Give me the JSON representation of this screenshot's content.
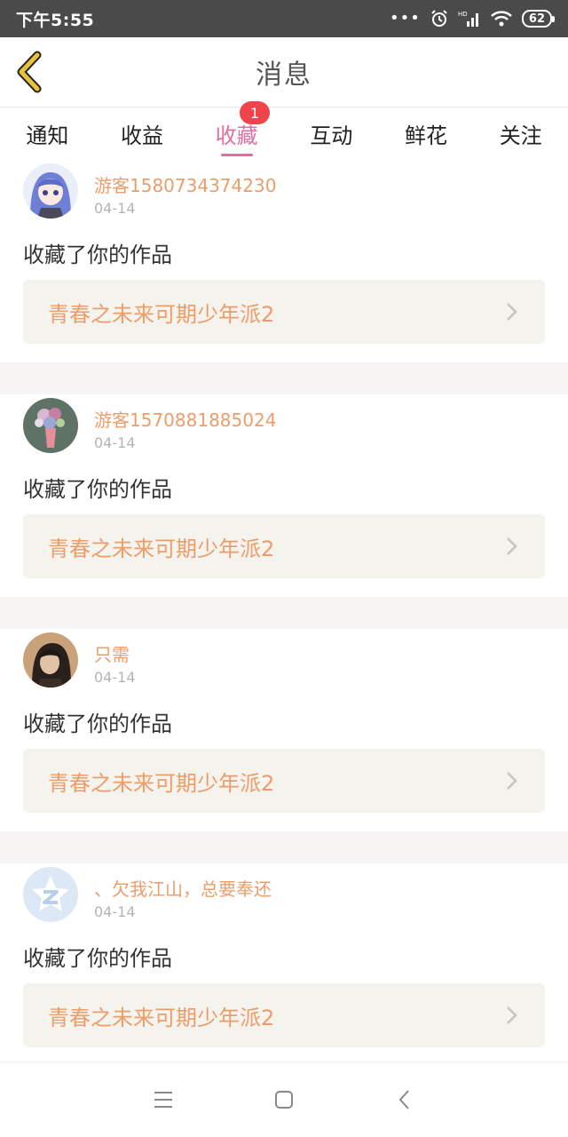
{
  "status_bar": {
    "time": "下午5:55",
    "dots": "•••",
    "battery": "62"
  },
  "header": {
    "title": "消息"
  },
  "tabs": [
    {
      "label": "通知",
      "active": false
    },
    {
      "label": "收益",
      "active": false
    },
    {
      "label": "收藏",
      "active": true,
      "badge": "1"
    },
    {
      "label": "互动",
      "active": false
    },
    {
      "label": "鲜花",
      "active": false
    },
    {
      "label": "关注",
      "active": false
    }
  ],
  "items": [
    {
      "name": "游客1580734374230",
      "date": "04-14",
      "action": "收藏了你的作品",
      "work": "青春之未来可期少年派2",
      "avatar": "anime-girl-avatar"
    },
    {
      "name": "游客1570881885024",
      "date": "04-14",
      "action": "收藏了你的作品",
      "work": "青春之未来可期少年派2",
      "avatar": "flower-vase-avatar"
    },
    {
      "name": "只需",
      "date": "04-14",
      "action": "收藏了你的作品",
      "work": "青春之未来可期少年派2",
      "avatar": "portrait-avatar"
    },
    {
      "name": "、欠我江山，总要奉还",
      "date": "04-14",
      "action": "收藏了你的作品",
      "work": "青春之未来可期少年派2",
      "avatar": "qzone-default-avatar"
    }
  ],
  "colors": {
    "accent": "#e46d9f",
    "name": "#ec9d6a",
    "badge": "#f0434b",
    "back_icon": "#e8c33a"
  }
}
